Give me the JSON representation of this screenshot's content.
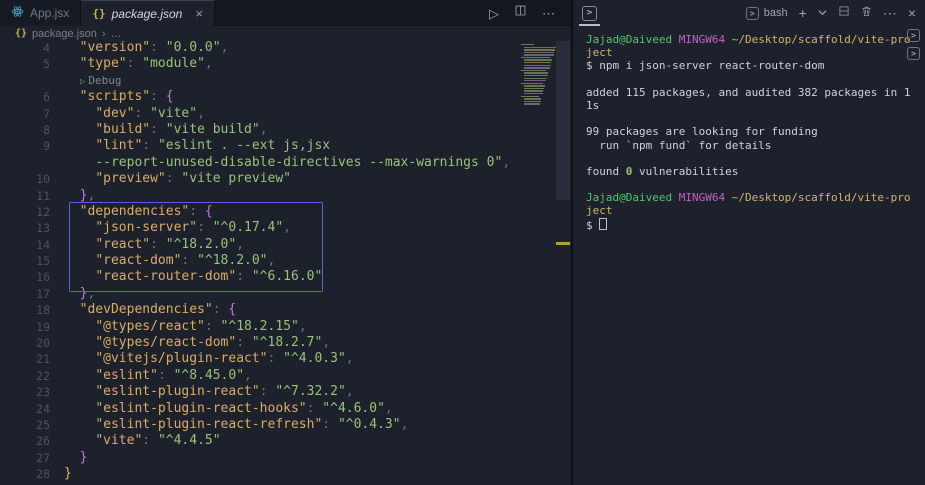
{
  "tabs": [
    {
      "label": "App.jsx"
    },
    {
      "label": "package.json"
    }
  ],
  "icons": {
    "braces": "{}",
    "run": "▷",
    "more": "⋯",
    "close": "×",
    "plus": "+",
    "tab_close": "×",
    "terminal_prompt": ">",
    "breadcrumb_sep": "›",
    "breadcrumb_more": "…",
    "lens_tri": "▷"
  },
  "breadcrumb": {
    "file": "package.json",
    "symbol": "…"
  },
  "panel": {
    "shell_label": "bash"
  },
  "editor": {
    "rows": [
      {
        "n": "4",
        "seg": [
          {
            "t": "  "
          },
          {
            "t": "\"version\"",
            "c": "k"
          },
          {
            "t": ": ",
            "c": "p"
          },
          {
            "t": "\"0.0.0\"",
            "c": "s"
          },
          {
            "t": ",",
            "c": "p"
          }
        ]
      },
      {
        "n": "5",
        "seg": [
          {
            "t": "  "
          },
          {
            "t": "\"type\"",
            "c": "k"
          },
          {
            "t": ": ",
            "c": "p"
          },
          {
            "t": "\"module\"",
            "c": "s"
          },
          {
            "t": ",",
            "c": "p"
          }
        ]
      },
      {
        "lens": true,
        "label": "Debug"
      },
      {
        "n": "6",
        "seg": [
          {
            "t": "  "
          },
          {
            "t": "\"scripts\"",
            "c": "k"
          },
          {
            "t": ": ",
            "c": "p"
          },
          {
            "t": "{",
            "c": "b2"
          }
        ]
      },
      {
        "n": "7",
        "seg": [
          {
            "t": "    "
          },
          {
            "t": "\"dev\"",
            "c": "k"
          },
          {
            "t": ": ",
            "c": "p"
          },
          {
            "t": "\"vite\"",
            "c": "s"
          },
          {
            "t": ",",
            "c": "p"
          }
        ]
      },
      {
        "n": "8",
        "seg": [
          {
            "t": "    "
          },
          {
            "t": "\"build\"",
            "c": "k"
          },
          {
            "t": ": ",
            "c": "p"
          },
          {
            "t": "\"vite build\"",
            "c": "s"
          },
          {
            "t": ",",
            "c": "p"
          }
        ]
      },
      {
        "n": "9",
        "seg": [
          {
            "t": "    "
          },
          {
            "t": "\"lint\"",
            "c": "k"
          },
          {
            "t": ": ",
            "c": "p"
          },
          {
            "t": "\"eslint . --ext js,jsx",
            "c": "s"
          }
        ]
      },
      {
        "n": "",
        "seg": [
          {
            "t": "    "
          },
          {
            "t": "--report-unused-disable-directives --max-warnings 0\"",
            "c": "s"
          },
          {
            "t": ",",
            "c": "p"
          }
        ]
      },
      {
        "n": "10",
        "seg": [
          {
            "t": "    "
          },
          {
            "t": "\"preview\"",
            "c": "k"
          },
          {
            "t": ": ",
            "c": "p"
          },
          {
            "t": "\"vite preview\"",
            "c": "s"
          }
        ]
      },
      {
        "n": "11",
        "seg": [
          {
            "t": "  "
          },
          {
            "t": "}",
            "c": "b2"
          },
          {
            "t": ",",
            "c": "p"
          }
        ]
      },
      {
        "n": "12",
        "seg": [
          {
            "t": "  "
          },
          {
            "t": "\"dependencies\"",
            "c": "k"
          },
          {
            "t": ": ",
            "c": "p"
          },
          {
            "t": "{",
            "c": "b2"
          }
        ]
      },
      {
        "n": "13",
        "seg": [
          {
            "t": "    "
          },
          {
            "t": "\"json-server\"",
            "c": "k"
          },
          {
            "t": ": ",
            "c": "p"
          },
          {
            "t": "\"^0.17.4\"",
            "c": "s"
          },
          {
            "t": ",",
            "c": "p"
          }
        ]
      },
      {
        "n": "14",
        "seg": [
          {
            "t": "    "
          },
          {
            "t": "\"react\"",
            "c": "k"
          },
          {
            "t": ": ",
            "c": "p"
          },
          {
            "t": "\"^18.2.0\"",
            "c": "s"
          },
          {
            "t": ",",
            "c": "p"
          }
        ]
      },
      {
        "n": "15",
        "seg": [
          {
            "t": "    "
          },
          {
            "t": "\"react-dom\"",
            "c": "k"
          },
          {
            "t": ": ",
            "c": "p"
          },
          {
            "t": "\"^18.2.0\"",
            "c": "s"
          },
          {
            "t": ",",
            "c": "p"
          }
        ]
      },
      {
        "n": "16",
        "seg": [
          {
            "t": "    "
          },
          {
            "t": "\"react-router-dom\"",
            "c": "k"
          },
          {
            "t": ": ",
            "c": "p"
          },
          {
            "t": "\"^6.16.0\"",
            "c": "s"
          }
        ]
      },
      {
        "n": "17",
        "seg": [
          {
            "t": "  "
          },
          {
            "t": "}",
            "c": "b2"
          },
          {
            "t": ",",
            "c": "p"
          }
        ]
      },
      {
        "n": "18",
        "seg": [
          {
            "t": "  "
          },
          {
            "t": "\"devDependencies\"",
            "c": "k"
          },
          {
            "t": ": ",
            "c": "p"
          },
          {
            "t": "{",
            "c": "b2"
          }
        ]
      },
      {
        "n": "19",
        "seg": [
          {
            "t": "    "
          },
          {
            "t": "\"@types/react\"",
            "c": "k"
          },
          {
            "t": ": ",
            "c": "p"
          },
          {
            "t": "\"^18.2.15\"",
            "c": "s"
          },
          {
            "t": ",",
            "c": "p"
          }
        ]
      },
      {
        "n": "20",
        "seg": [
          {
            "t": "    "
          },
          {
            "t": "\"@types/react-dom\"",
            "c": "k"
          },
          {
            "t": ": ",
            "c": "p"
          },
          {
            "t": "\"^18.2.7\"",
            "c": "s"
          },
          {
            "t": ",",
            "c": "p"
          }
        ]
      },
      {
        "n": "21",
        "seg": [
          {
            "t": "    "
          },
          {
            "t": "\"@vitejs/plugin-react\"",
            "c": "k"
          },
          {
            "t": ": ",
            "c": "p"
          },
          {
            "t": "\"^4.0.3\"",
            "c": "s"
          },
          {
            "t": ",",
            "c": "p"
          }
        ]
      },
      {
        "n": "22",
        "seg": [
          {
            "t": "    "
          },
          {
            "t": "\"eslint\"",
            "c": "k"
          },
          {
            "t": ": ",
            "c": "p"
          },
          {
            "t": "\"^8.45.0\"",
            "c": "s"
          },
          {
            "t": ",",
            "c": "p"
          }
        ]
      },
      {
        "n": "23",
        "seg": [
          {
            "t": "    "
          },
          {
            "t": "\"eslint-plugin-react\"",
            "c": "k"
          },
          {
            "t": ": ",
            "c": "p"
          },
          {
            "t": "\"^7.32.2\"",
            "c": "s"
          },
          {
            "t": ",",
            "c": "p"
          }
        ]
      },
      {
        "n": "24",
        "seg": [
          {
            "t": "    "
          },
          {
            "t": "\"eslint-plugin-react-hooks\"",
            "c": "k"
          },
          {
            "t": ": ",
            "c": "p"
          },
          {
            "t": "\"^4.6.0\"",
            "c": "s"
          },
          {
            "t": ",",
            "c": "p"
          }
        ]
      },
      {
        "n": "25",
        "seg": [
          {
            "t": "    "
          },
          {
            "t": "\"eslint-plugin-react-refresh\"",
            "c": "k"
          },
          {
            "t": ": ",
            "c": "p"
          },
          {
            "t": "\"^0.4.3\"",
            "c": "s"
          },
          {
            "t": ",",
            "c": "p"
          }
        ]
      },
      {
        "n": "26",
        "seg": [
          {
            "t": "    "
          },
          {
            "t": "\"vite\"",
            "c": "k"
          },
          {
            "t": ": ",
            "c": "p"
          },
          {
            "t": "\"^4.4.5\"",
            "c": "s"
          }
        ]
      },
      {
        "n": "27",
        "seg": [
          {
            "t": "  "
          },
          {
            "t": "}",
            "c": "b2"
          }
        ]
      },
      {
        "n": "28",
        "seg": [
          {
            "t": "}",
            "c": "b1"
          }
        ]
      }
    ]
  },
  "terminal": {
    "rows": [
      {
        "seg": [
          {
            "t": "Jajad@Daiveed",
            "c": "g"
          },
          {
            "t": " "
          },
          {
            "t": "MINGW64",
            "c": "m"
          },
          {
            "t": " "
          },
          {
            "t": "~/Desktop/scaffold/vite-pro",
            "c": "y"
          }
        ]
      },
      {
        "seg": [
          {
            "t": "ject",
            "c": "y"
          }
        ]
      },
      {
        "seg": [
          {
            "t": "$ npm i json-server react-router-dom"
          }
        ]
      },
      {
        "seg": []
      },
      {
        "seg": [
          {
            "t": "added 115 packages, and audited 382 packages in 1"
          }
        ]
      },
      {
        "seg": [
          {
            "t": "1s"
          }
        ]
      },
      {
        "seg": []
      },
      {
        "seg": [
          {
            "t": "99 packages are looking for funding"
          }
        ]
      },
      {
        "seg": [
          {
            "t": "  run `npm fund` for details"
          }
        ]
      },
      {
        "seg": []
      },
      {
        "seg": [
          {
            "t": "found "
          },
          {
            "t": "0",
            "c": "gb"
          },
          {
            "t": " vulnerabilities"
          }
        ]
      },
      {
        "seg": []
      },
      {
        "seg": [
          {
            "t": "Jajad@Daiveed",
            "c": "g"
          },
          {
            "t": " "
          },
          {
            "t": "MINGW64",
            "c": "m"
          },
          {
            "t": " "
          },
          {
            "t": "~/Desktop/scaffold/vite-pro",
            "c": "y"
          }
        ]
      },
      {
        "seg": [
          {
            "t": "ject",
            "c": "y"
          }
        ]
      },
      {
        "seg": [
          {
            "t": "$ "
          },
          {
            "cursor": true
          }
        ]
      }
    ]
  }
}
